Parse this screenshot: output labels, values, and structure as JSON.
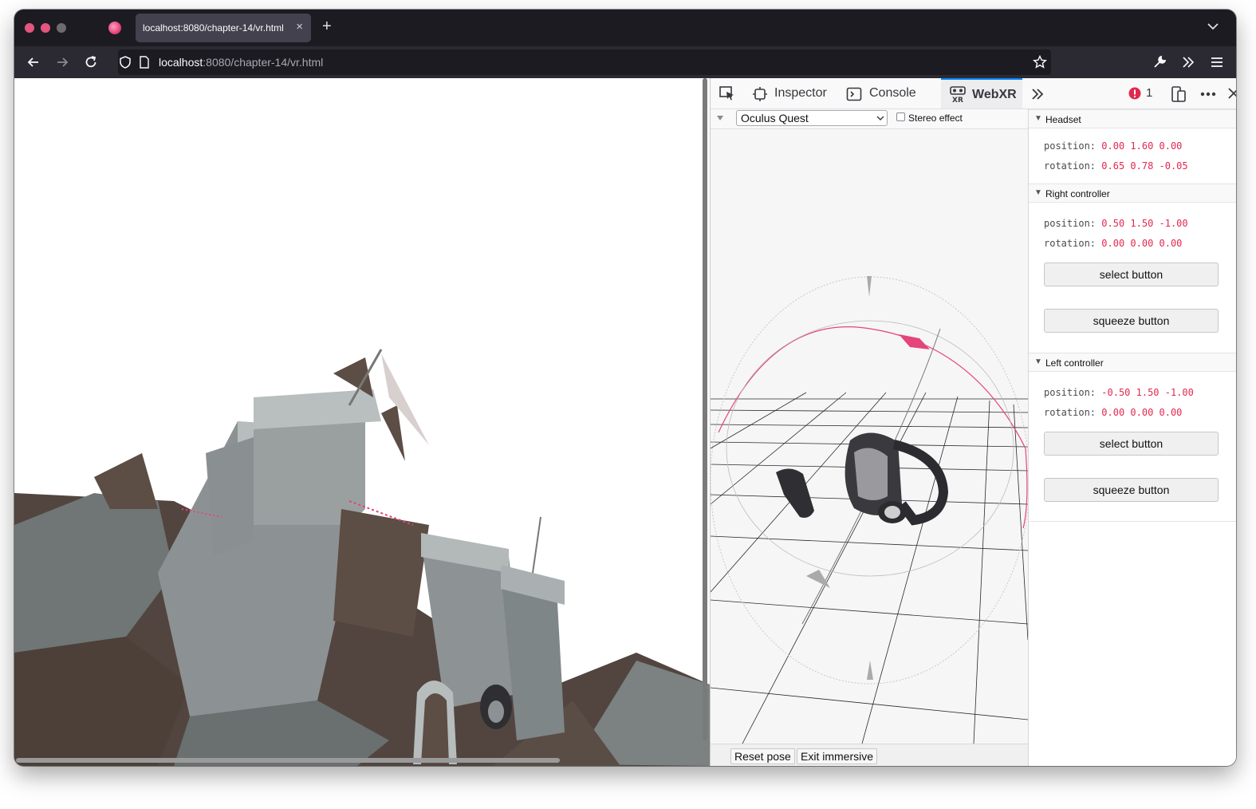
{
  "browser": {
    "tab_title": "localhost:8080/chapter-14/vr.html",
    "tab_close": "×",
    "new_tab": "+",
    "url_host": "localhost",
    "url_path": ":8080/chapter-14/vr.html"
  },
  "devtools": {
    "tabs": [
      {
        "label": "Inspector"
      },
      {
        "label": "Console"
      },
      {
        "label": "WebXR"
      }
    ],
    "error_count": "1",
    "device_select": "Oculus Quest",
    "stereo_label": "Stereo effect",
    "reset_pose": "Reset pose",
    "exit_immersive": "Exit immersive"
  },
  "panel": {
    "headset": {
      "title": "Headset",
      "position_key": "position:",
      "position_val": "0.00 1.60 0.00",
      "rotation_key": "rotation:",
      "rotation_val": "0.65 0.78 -0.05"
    },
    "right": {
      "title": "Right controller",
      "position_key": "position:",
      "position_val": "0.50 1.50 -1.00",
      "rotation_key": "rotation:",
      "rotation_val": "0.00 0.00 0.00",
      "select": "select button",
      "squeeze": "squeeze button"
    },
    "left": {
      "title": "Left controller",
      "position_key": "position:",
      "position_val": "-0.50 1.50 -1.00",
      "rotation_key": "rotation:",
      "rotation_val": "0.00 0.00 0.00",
      "select": "select button",
      "squeeze": "squeeze button"
    }
  },
  "colors": {
    "accent": "#e4457a",
    "value_text": "#e22850",
    "selected_tab": "#0a84ff"
  },
  "icons": [
    "back-icon",
    "forward-icon",
    "reload-icon",
    "shield-icon",
    "page-icon",
    "star-icon",
    "wrench-icon",
    "overflow-icon",
    "menu-icon",
    "picker-icon",
    "inspector-icon",
    "console-icon",
    "webxr-icon",
    "error-icon",
    "responsive-icon",
    "more-icon",
    "close-icon"
  ]
}
